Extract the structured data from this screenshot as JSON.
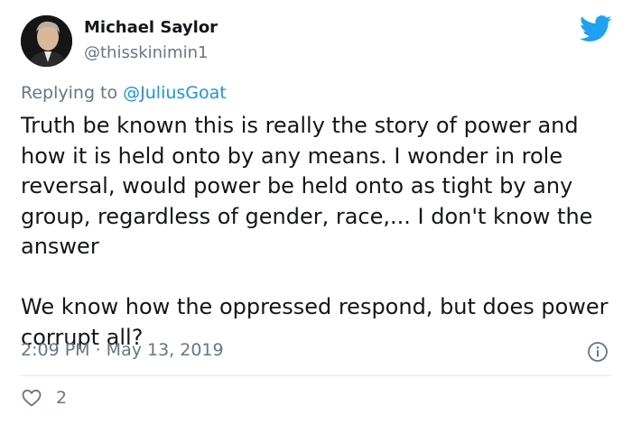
{
  "author": {
    "name": "Michael Saylor",
    "handle": "@thisskinimin1"
  },
  "reply": {
    "prefix": "Replying to ",
    "mention": "@JuliusGoat"
  },
  "tweet": {
    "paragraph_1": "Truth be known this is really the story of power and how it is held onto by any means. I wonder in role reversal, would power be held onto as tight by any group, regardless of gender, race,... I don't know the answer",
    "paragraph_2": "We know how the oppressed respond, but does power corrupt all?",
    "timestamp": "2:09 PM · May 13, 2019"
  },
  "actions": {
    "likes": "2"
  },
  "icons": {
    "brand": "twitter-bird-icon",
    "info": "info-icon",
    "like": "heart-icon"
  },
  "colors": {
    "brand_blue": "#1da1f2",
    "secondary_text": "#657786",
    "link_blue": "#1b95e0",
    "divider": "#e1e8ed"
  }
}
